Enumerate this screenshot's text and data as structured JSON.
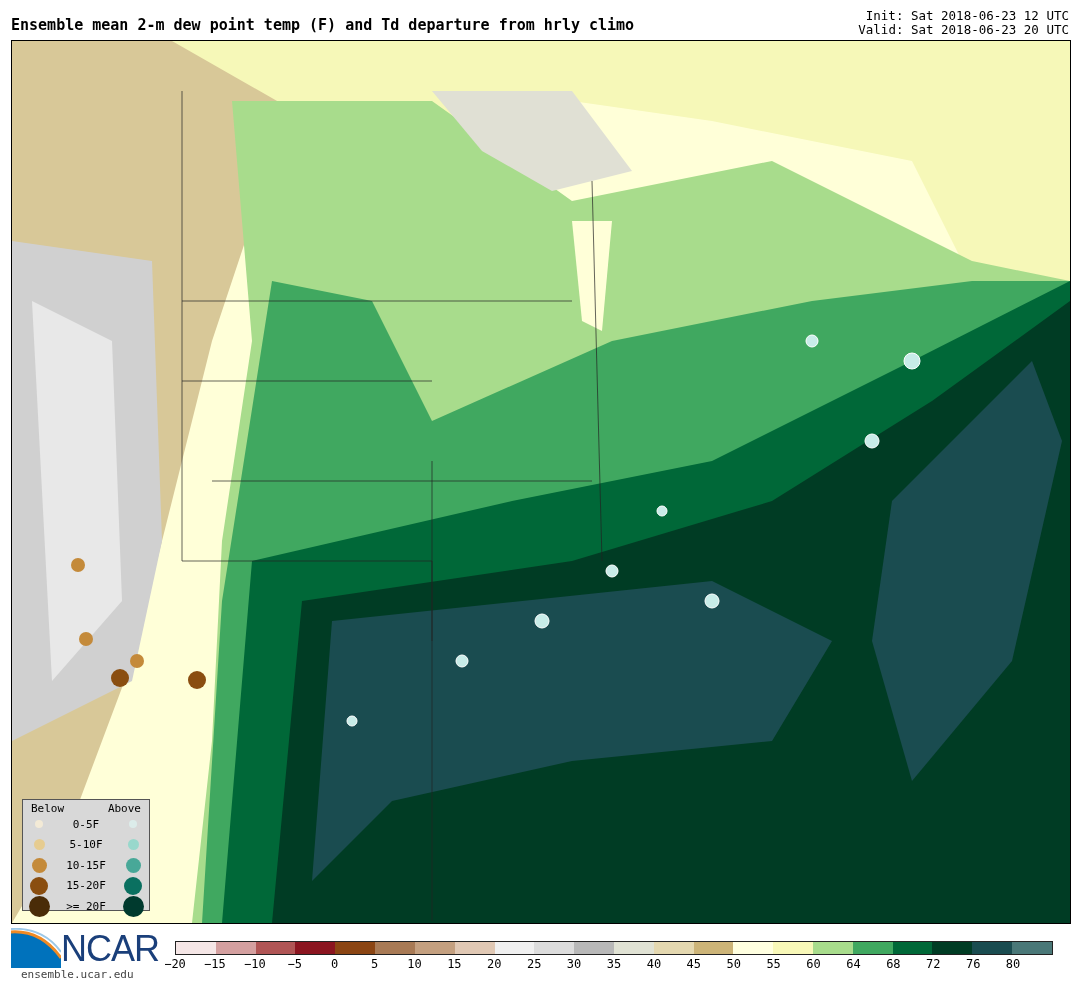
{
  "header": {
    "title": "Ensemble mean 2-m dew point temp (F) and Td departure from hrly climo",
    "init": "Init: Sat 2018-06-23 12 UTC",
    "valid": "Valid: Sat 2018-06-23 20 UTC"
  },
  "legend": {
    "below_label": "Below",
    "above_label": "Above",
    "rows": [
      {
        "label": "0-5F",
        "below": {
          "color": "#f3ead6"
        },
        "above": {
          "color": "#dcecea"
        }
      },
      {
        "label": "5-10F",
        "below": {
          "color": "#e6cc90"
        },
        "above": {
          "color": "#98d8cc"
        }
      },
      {
        "label": "10-15F",
        "below": {
          "color": "#c48a3a"
        },
        "above": {
          "color": "#48a898"
        }
      },
      {
        "label": "15-20F",
        "below": {
          "color": "#8a4e10"
        },
        "above": {
          "color": "#0a7060"
        }
      },
      {
        "label": ">= 20F",
        "below": {
          "color": "#4a2c08"
        },
        "above": {
          "color": "#003a2e"
        }
      }
    ]
  },
  "logo": {
    "text": "NCAR",
    "url": "ensemble.ucar.edu"
  },
  "colorbar": {
    "bins": [
      {
        "color": "#f5e6e6"
      },
      {
        "color": "#d4a0a0"
      },
      {
        "color": "#b05555"
      },
      {
        "color": "#8b1520"
      },
      {
        "color": "#8b4513"
      },
      {
        "color": "#a87a55"
      },
      {
        "color": "#c4a080"
      },
      {
        "color": "#e0c8b4"
      },
      {
        "color": "#f0f0f0"
      },
      {
        "color": "#dcdcdc"
      },
      {
        "color": "#b8b8b8"
      },
      {
        "color": "#e0e2d4"
      },
      {
        "color": "#e4d8b0"
      },
      {
        "color": "#ccb478"
      },
      {
        "color": "#ffffe0"
      },
      {
        "color": "#f8f8b8"
      },
      {
        "color": "#a8dc8c"
      },
      {
        "color": "#40a860"
      },
      {
        "color": "#006838"
      },
      {
        "color": "#003c24"
      },
      {
        "color": "#1a4c50"
      },
      {
        "color": "#4a7878"
      }
    ],
    "ticks": [
      "−20",
      "−15",
      "−10",
      "−5",
      "0",
      "5",
      "10",
      "15",
      "20",
      "25",
      "30",
      "35",
      "40",
      "45",
      "50",
      "55",
      "60",
      "64",
      "68",
      "72",
      "76",
      "80"
    ]
  }
}
